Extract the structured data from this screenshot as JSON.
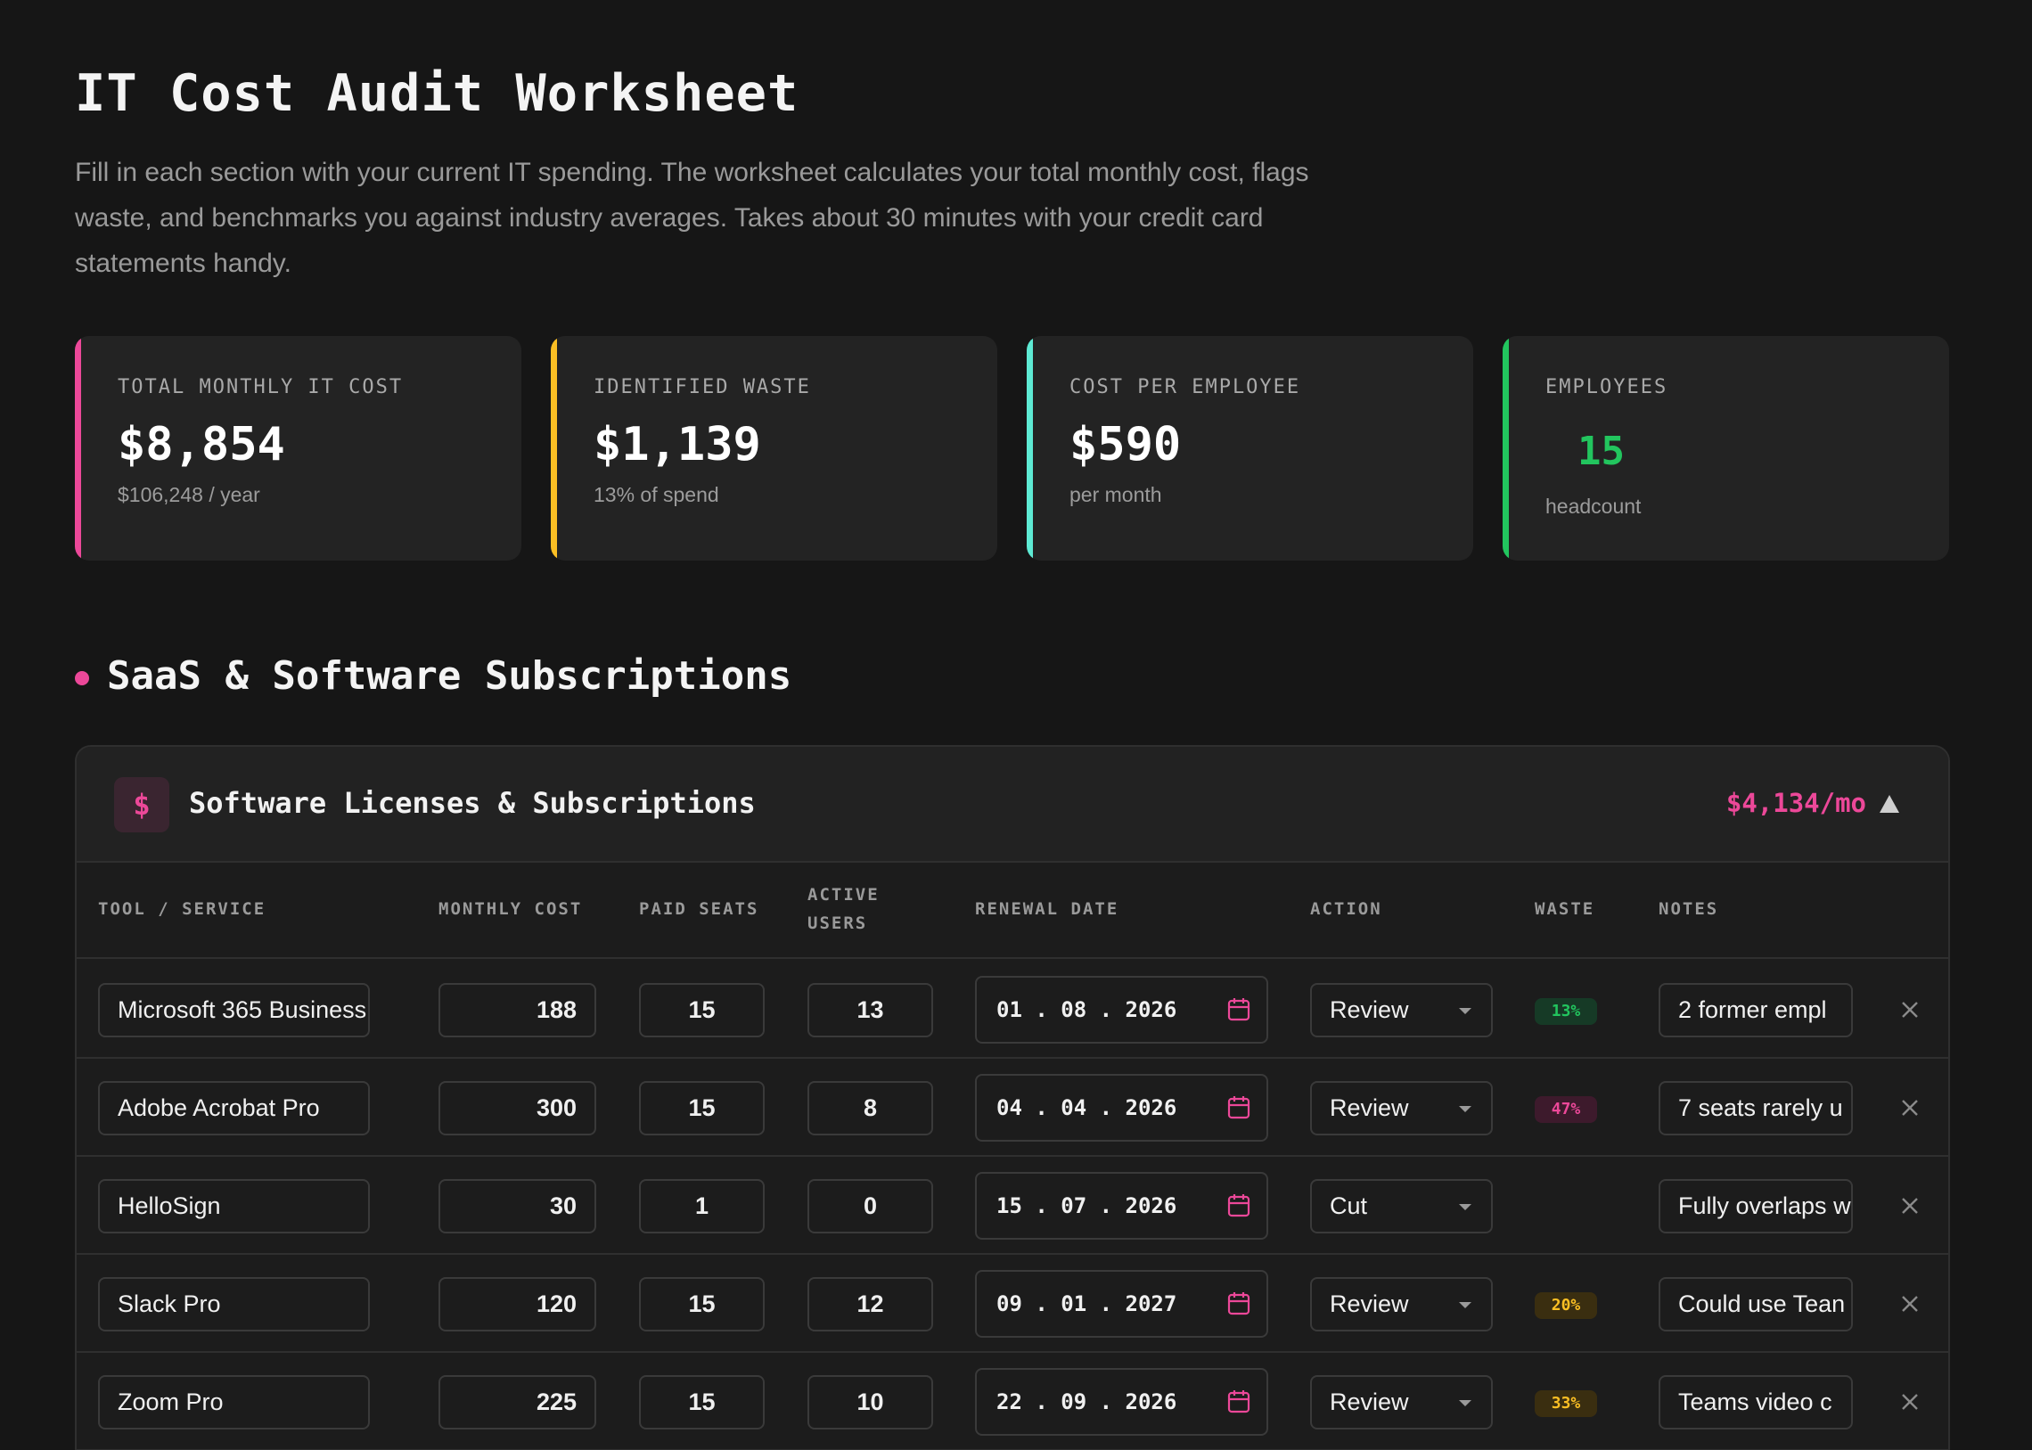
{
  "page": {
    "title": "IT Cost Audit Worksheet",
    "description": "Fill in each section with your current IT spending. The worksheet calculates your total monthly cost, flags waste, and benchmarks you against industry averages. Takes about 30 minutes with your credit card statements handy."
  },
  "stats": [
    {
      "label": "TOTAL MONTHLY IT COST",
      "value": "$8,854",
      "sub": "$106,248 / year",
      "accent": "#ec4899"
    },
    {
      "label": "IDENTIFIED WASTE",
      "value": "$1,139",
      "sub": "13% of spend",
      "accent": "#fbbf24"
    },
    {
      "label": "COST PER EMPLOYEE",
      "value": "$590",
      "sub": "per month",
      "accent": "#5eead4"
    },
    {
      "label": "EMPLOYEES",
      "value": "15",
      "sub": "headcount",
      "accent": "#22c55e"
    }
  ],
  "section": {
    "title": "SaaS & Software Subscriptions"
  },
  "panel": {
    "icon": "dollar-icon",
    "icon_glyph": "$",
    "title": "Software Licenses & Subscriptions",
    "total": "$4,134/mo",
    "columns": {
      "tool": "TOOL / SERVICE",
      "cost": "MONTHLY COST",
      "seats": "PAID SEATS",
      "users_line1": "ACTIVE",
      "users_line2": "USERS",
      "renewal": "RENEWAL DATE",
      "action": "ACTION",
      "waste": "WASTE",
      "notes": "NOTES"
    },
    "rows": [
      {
        "name": "Microsoft 365 Business",
        "cost": "188",
        "seats": "15",
        "users": "13",
        "date": "01.08.2026",
        "action": "Review",
        "waste": "13%",
        "waste_color": "green",
        "notes": "2 former empl"
      },
      {
        "name": "Adobe Acrobat Pro",
        "cost": "300",
        "seats": "15",
        "users": "8",
        "date": "04.04.2026",
        "action": "Review",
        "waste": "47%",
        "waste_color": "pink",
        "notes": "7 seats rarely u"
      },
      {
        "name": "HelloSign",
        "cost": "30",
        "seats": "1",
        "users": "0",
        "date": "15.07.2026",
        "action": "Cut",
        "waste": "",
        "waste_color": "",
        "notes": "Fully overlaps w"
      },
      {
        "name": "Slack Pro",
        "cost": "120",
        "seats": "15",
        "users": "12",
        "date": "09.01.2027",
        "action": "Review",
        "waste": "20%",
        "waste_color": "yellow",
        "notes": "Could use Tean"
      },
      {
        "name": "Zoom Pro",
        "cost": "225",
        "seats": "15",
        "users": "10",
        "date": "22.09.2026",
        "action": "Review",
        "waste": "33%",
        "waste_color": "yellow",
        "notes": "Teams video c"
      }
    ]
  },
  "colors": {
    "pink": "#ec4899",
    "yellow": "#fbbf24",
    "cyan": "#5eead4",
    "green": "#22c55e",
    "badge_green_bg": "#163a26",
    "badge_green_fg": "#22c55e",
    "badge_pink_bg": "#3d1a2c",
    "badge_pink_fg": "#ec4899",
    "badge_yellow_bg": "#3a2e10",
    "badge_yellow_fg": "#fbbf24"
  }
}
